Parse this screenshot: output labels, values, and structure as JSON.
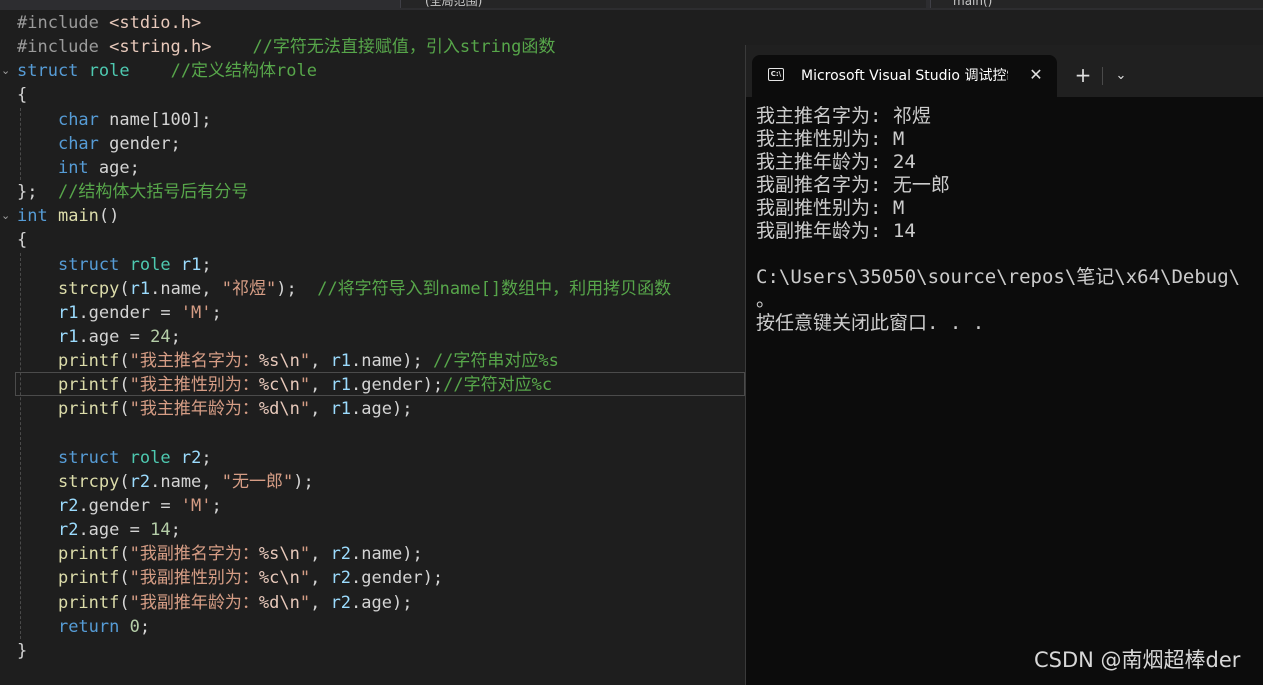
{
  "editor": {
    "top_bar": {
      "scope_dropdown": "(全局范围)",
      "member_dropdown": "main()"
    },
    "code": [
      [
        [
          "pp",
          "#include "
        ],
        [
          "inc",
          "<stdio.h>"
        ]
      ],
      [
        [
          "pp",
          "#include "
        ],
        [
          "inc",
          "<string.h>"
        ],
        [
          "tx",
          "    "
        ],
        [
          "cm",
          "//字符无法直接赋值，引入string函数"
        ]
      ],
      [
        [
          "kw",
          "struct"
        ],
        [
          "tx",
          " "
        ],
        [
          "typ",
          "role"
        ],
        [
          "tx",
          "    "
        ],
        [
          "cm",
          "//定义结构体role"
        ]
      ],
      [
        [
          "tx",
          "{"
        ]
      ],
      [
        [
          "tx",
          "    "
        ],
        [
          "kw",
          "char"
        ],
        [
          "tx",
          " name[100];"
        ]
      ],
      [
        [
          "tx",
          "    "
        ],
        [
          "kw",
          "char"
        ],
        [
          "tx",
          " gender;"
        ]
      ],
      [
        [
          "tx",
          "    "
        ],
        [
          "kw",
          "int"
        ],
        [
          "tx",
          " age;"
        ]
      ],
      [
        [
          "tx",
          "};  "
        ],
        [
          "cm",
          "//结构体大括号后有分号"
        ]
      ],
      [
        [
          "kw",
          "int"
        ],
        [
          "tx",
          " "
        ],
        [
          "fn",
          "main"
        ],
        [
          "tx",
          "()"
        ]
      ],
      [
        [
          "tx",
          "{"
        ]
      ],
      [
        [
          "tx",
          "    "
        ],
        [
          "kw",
          "struct"
        ],
        [
          "tx",
          " "
        ],
        [
          "typ",
          "role"
        ],
        [
          "tx",
          " "
        ],
        [
          "var",
          "r1"
        ],
        [
          "tx",
          ";"
        ]
      ],
      [
        [
          "tx",
          "    "
        ],
        [
          "fn",
          "strcpy"
        ],
        [
          "tx",
          "("
        ],
        [
          "var",
          "r1"
        ],
        [
          "tx",
          ".name, "
        ],
        [
          "str",
          "\"祁煜\""
        ],
        [
          "tx",
          ");  "
        ],
        [
          "cm",
          "//将字符导入到name[]数组中，利用拷贝函数"
        ]
      ],
      [
        [
          "tx",
          "    "
        ],
        [
          "var",
          "r1"
        ],
        [
          "tx",
          ".gender = "
        ],
        [
          "str",
          "'M'"
        ],
        [
          "tx",
          ";"
        ]
      ],
      [
        [
          "tx",
          "    "
        ],
        [
          "var",
          "r1"
        ],
        [
          "tx",
          ".age = "
        ],
        [
          "num",
          "24"
        ],
        [
          "tx",
          ";"
        ]
      ],
      [
        [
          "tx",
          "    "
        ],
        [
          "fn",
          "printf"
        ],
        [
          "tx",
          "("
        ],
        [
          "str",
          "\"我主推名字为："
        ],
        [
          "esc",
          "%s\\n"
        ],
        [
          "str",
          "\""
        ],
        [
          "tx",
          ", "
        ],
        [
          "var",
          "r1"
        ],
        [
          "tx",
          ".name); "
        ],
        [
          "cm",
          "//字符串对应%s"
        ]
      ],
      [
        [
          "tx",
          "    "
        ],
        [
          "fn",
          "printf"
        ],
        [
          "tx",
          "("
        ],
        [
          "str",
          "\"我主推性别为："
        ],
        [
          "esc",
          "%c\\n"
        ],
        [
          "str",
          "\""
        ],
        [
          "tx",
          ", "
        ],
        [
          "var",
          "r1"
        ],
        [
          "tx",
          ".gender);"
        ],
        [
          "cm",
          "//字符对应%c"
        ]
      ],
      [
        [
          "tx",
          "    "
        ],
        [
          "fn",
          "printf"
        ],
        [
          "tx",
          "("
        ],
        [
          "str",
          "\"我主推年龄为："
        ],
        [
          "esc",
          "%d\\n"
        ],
        [
          "str",
          "\""
        ],
        [
          "tx",
          ", "
        ],
        [
          "var",
          "r1"
        ],
        [
          "tx",
          ".age);"
        ]
      ],
      [],
      [
        [
          "tx",
          "    "
        ],
        [
          "kw",
          "struct"
        ],
        [
          "tx",
          " "
        ],
        [
          "typ",
          "role"
        ],
        [
          "tx",
          " "
        ],
        [
          "var",
          "r2"
        ],
        [
          "tx",
          ";"
        ]
      ],
      [
        [
          "tx",
          "    "
        ],
        [
          "fn",
          "strcpy"
        ],
        [
          "tx",
          "("
        ],
        [
          "var",
          "r2"
        ],
        [
          "tx",
          ".name, "
        ],
        [
          "str",
          "\"无一郎\""
        ],
        [
          "tx",
          ");"
        ]
      ],
      [
        [
          "tx",
          "    "
        ],
        [
          "var",
          "r2"
        ],
        [
          "tx",
          ".gender = "
        ],
        [
          "str",
          "'M'"
        ],
        [
          "tx",
          ";"
        ]
      ],
      [
        [
          "tx",
          "    "
        ],
        [
          "var",
          "r2"
        ],
        [
          "tx",
          ".age = "
        ],
        [
          "num",
          "14"
        ],
        [
          "tx",
          ";"
        ]
      ],
      [
        [
          "tx",
          "    "
        ],
        [
          "fn",
          "printf"
        ],
        [
          "tx",
          "("
        ],
        [
          "str",
          "\"我副推名字为："
        ],
        [
          "esc",
          "%s\\n"
        ],
        [
          "str",
          "\""
        ],
        [
          "tx",
          ", "
        ],
        [
          "var",
          "r2"
        ],
        [
          "tx",
          ".name);"
        ]
      ],
      [
        [
          "tx",
          "    "
        ],
        [
          "fn",
          "printf"
        ],
        [
          "tx",
          "("
        ],
        [
          "str",
          "\"我副推性别为："
        ],
        [
          "esc",
          "%c\\n"
        ],
        [
          "str",
          "\""
        ],
        [
          "tx",
          ", "
        ],
        [
          "var",
          "r2"
        ],
        [
          "tx",
          ".gender);"
        ]
      ],
      [
        [
          "tx",
          "    "
        ],
        [
          "fn",
          "printf"
        ],
        [
          "tx",
          "("
        ],
        [
          "str",
          "\"我副推年龄为："
        ],
        [
          "esc",
          "%d\\n"
        ],
        [
          "str",
          "\""
        ],
        [
          "tx",
          ", "
        ],
        [
          "var",
          "r2"
        ],
        [
          "tx",
          ".age);"
        ]
      ],
      [
        [
          "tx",
          "    "
        ],
        [
          "kw",
          "return"
        ],
        [
          "tx",
          " "
        ],
        [
          "num",
          "0"
        ],
        [
          "tx",
          ";"
        ]
      ],
      [
        [
          "tx",
          "}"
        ]
      ]
    ]
  },
  "console": {
    "tab_title": "Microsoft Visual Studio 调试控制台",
    "tab_icon": "C:\\",
    "close_glyph": "✕",
    "new_tab_glyph": "+",
    "dropdown_glyph": "⌄",
    "lines": [
      "我主推名字为: 祁煜",
      "我主推性别为: M",
      "我主推年龄为: 24",
      "我副推名字为: 无一郎",
      "我副推性别为: M",
      "我副推年龄为: 14",
      "",
      "C:\\Users\\35050\\source\\repos\\笔记\\x64\\Debug\\",
      "。",
      "按任意键关闭此窗口. . ."
    ]
  },
  "watermark": "CSDN @南烟超棒der",
  "colors": {
    "editor_bg": "#1e1e1e",
    "keyword": "#569cd6",
    "comment": "#57a64a",
    "string": "#d69d85",
    "console_bg": "#0c0c0c"
  }
}
